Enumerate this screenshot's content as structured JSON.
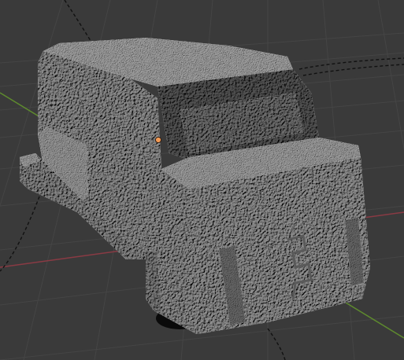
{
  "viewport": {
    "mode": "3D Viewport",
    "shading": "solid",
    "show_grid_floor": true,
    "show_axis_x": true,
    "show_axis_y": true,
    "show_origin": true
  },
  "scene": {
    "object_type": "mesh",
    "surface": "sculpted",
    "selection": "none"
  },
  "colors": {
    "background": "#3a3a3a",
    "grid_line": "#464646",
    "axis_x": "#8a3a44",
    "axis_y": "#5e8a2e",
    "dashed_guide": "#0f0f0f",
    "origin_fill": "#f19a55",
    "origin_stroke": "#2b1a10",
    "mesh_light": "#a6a6a6",
    "mesh_mid": "#8c8c8c",
    "mesh_dark": "#676767",
    "mesh_shadow": "#3d3d3d",
    "ground_shadow": "#0a0a0a"
  }
}
